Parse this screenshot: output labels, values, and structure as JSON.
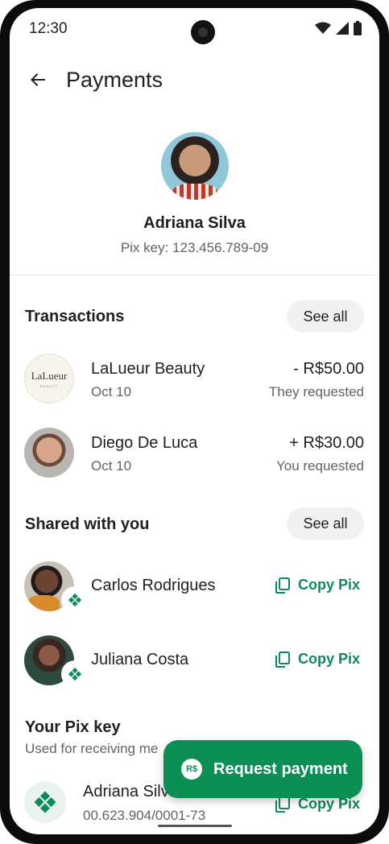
{
  "status_bar": {
    "time": "12:30"
  },
  "app_bar": {
    "title": "Payments"
  },
  "profile": {
    "name": "Adriana Silva",
    "pix_key_text": "Pix key: 123.456.789-09"
  },
  "transactions": {
    "title": "Transactions",
    "see_all": "See all",
    "items": [
      {
        "name": "LaLueur Beauty",
        "date": "Oct 10",
        "amount": "- R$50.00",
        "note": "They requested",
        "logo_text": "LaLueur",
        "logo_sub": "BEAUTY"
      },
      {
        "name": "Diego De Luca",
        "date": "Oct 10",
        "amount": "+ R$30.00",
        "note": "You requested"
      }
    ]
  },
  "shared": {
    "title": "Shared with you",
    "see_all": "See all",
    "items": [
      {
        "name": "Carlos Rodrigues",
        "action": "Copy Pix"
      },
      {
        "name": "Juliana Costa",
        "action": "Copy Pix"
      }
    ]
  },
  "your_pix": {
    "title": "Your Pix key",
    "subtitle": "Used for receiving me",
    "name": "Adriana Silva",
    "key": "00.623.904/0001-73",
    "action": "Copy Pix"
  },
  "fab": {
    "label": "Request payment",
    "icon_text": "R$"
  },
  "colors": {
    "accent": "#0b8a5a",
    "fab": "#0b8f54"
  }
}
